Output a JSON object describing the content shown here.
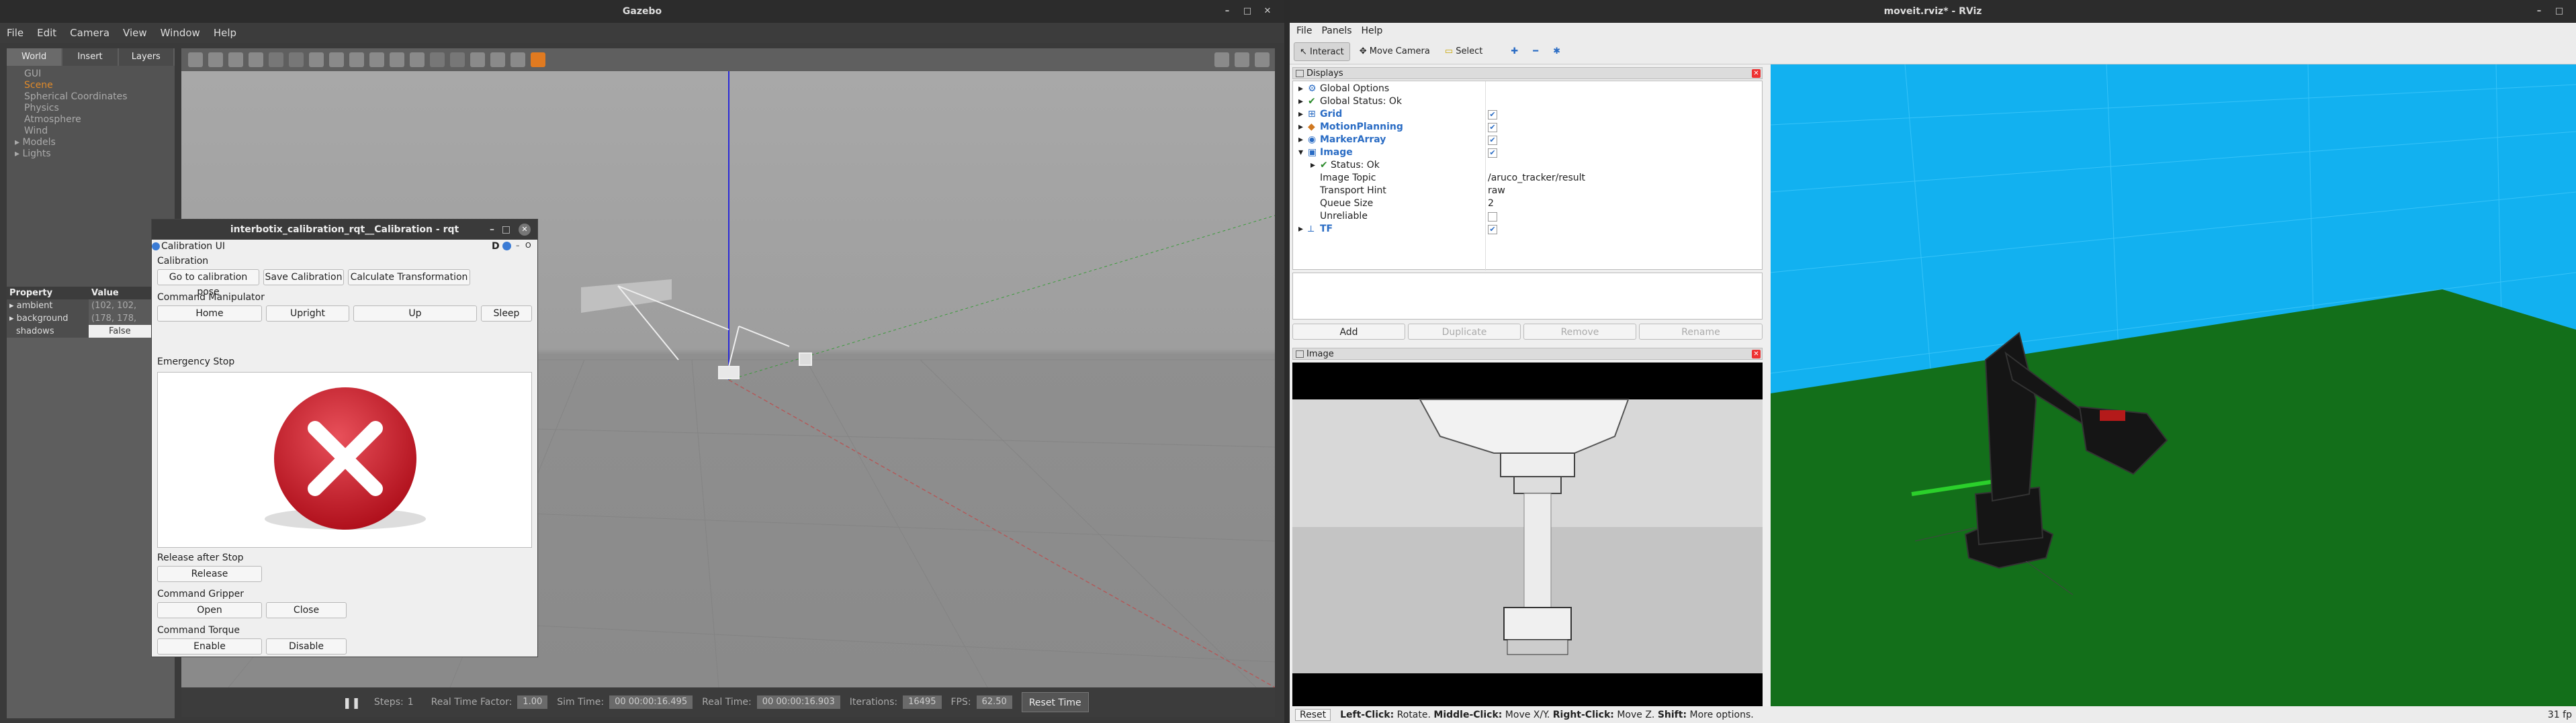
{
  "gazebo": {
    "title": "Gazebo",
    "menu": [
      "File",
      "Edit",
      "Camera",
      "View",
      "Window",
      "Help"
    ],
    "tabs": [
      "World",
      "Insert",
      "Layers"
    ],
    "tree": [
      "GUI",
      "Scene",
      "Spherical Coordinates",
      "Physics",
      "Atmosphere",
      "Wind",
      "Models",
      "Lights"
    ],
    "props_header": {
      "property": "Property",
      "value": "Value"
    },
    "props": [
      {
        "k": "ambient",
        "v": "(102, 102,"
      },
      {
        "k": "background",
        "v": "(178, 178,"
      },
      {
        "k": "shadows",
        "v": "False"
      }
    ],
    "status": {
      "steps_label": "Steps:",
      "steps_value": "1",
      "rtf_label": "Real Time Factor:",
      "rtf_value": "1.00",
      "sim_label": "Sim Time:",
      "sim_value": "00 00:00:16.495",
      "real_label": "Real Time:",
      "real_value": "00 00:00:16.903",
      "iter_label": "Iterations:",
      "iter_value": "16495",
      "fps_label": "FPS:",
      "fps_value": "62.50",
      "reset_label": "Reset Time"
    }
  },
  "calibration": {
    "title": "interbotix_calibration_rqt__Calibration - rqt",
    "ui_label": "Calibration UI",
    "corner": "D",
    "section_calibration": "Calibration",
    "go_btn": "Go to calibration pose",
    "save_btn": "Save Calibration",
    "calc_btn": "Calculate  Transformation",
    "section_manip": "Command Manipulator",
    "home_btn": "Home",
    "upright_btn": "Upright",
    "up_btn": "Up",
    "sleep_btn": "Sleep",
    "section_estop": "Emergency Stop",
    "section_release": "Release after Stop",
    "release_btn": "Release",
    "section_gripper": "Command Gripper",
    "open_btn": "Open",
    "close_btn": "Close",
    "section_torque": "Command Torque",
    "enable_btn": "Enable",
    "disable_btn": "Disable"
  },
  "rviz": {
    "title": "moveit.rviz* - RViz",
    "menu": [
      "File",
      "Panels",
      "Help"
    ],
    "tools": [
      "Interact",
      "Move Camera",
      "Select"
    ],
    "displays_title": "Displays",
    "displays": [
      {
        "name": "Global Options",
        "style": "plain",
        "indent": 0
      },
      {
        "name": "Global Status: Ok",
        "style": "plain",
        "indent": 0
      },
      {
        "name": "Grid",
        "style": "blue",
        "indent": 0,
        "checked": true
      },
      {
        "name": "MotionPlanning",
        "style": "blue",
        "indent": 0,
        "checked": true
      },
      {
        "name": "MarkerArray",
        "style": "blue",
        "indent": 0,
        "checked": true
      },
      {
        "name": "Image",
        "style": "blue",
        "indent": 0,
        "checked": true
      },
      {
        "name": "Status: Ok",
        "style": "plain",
        "indent": 1
      },
      {
        "name": "Image Topic",
        "style": "plain",
        "indent": 1,
        "value": "/aruco_tracker/result"
      },
      {
        "name": "Transport Hint",
        "style": "plain",
        "indent": 1,
        "value": "raw"
      },
      {
        "name": "Queue Size",
        "style": "plain",
        "indent": 1,
        "value": "2"
      },
      {
        "name": "Unreliable",
        "style": "plain",
        "indent": 1,
        "checked": false
      },
      {
        "name": "TF",
        "style": "blue",
        "indent": 0,
        "checked": true
      }
    ],
    "buttons": [
      "Add",
      "Duplicate",
      "Remove",
      "Rename"
    ],
    "image_title": "Image",
    "status": {
      "reset": "Reset",
      "hint1": "Left-Click:",
      "hint1v": " Rotate. ",
      "hint2": "Middle-Click:",
      "hint2v": " Move X/Y. ",
      "hint3": "Right-Click:",
      "hint3v": " Move Z. ",
      "hint4": "Shift:",
      "hint4v": " More options.",
      "fps": "31 fp"
    }
  }
}
